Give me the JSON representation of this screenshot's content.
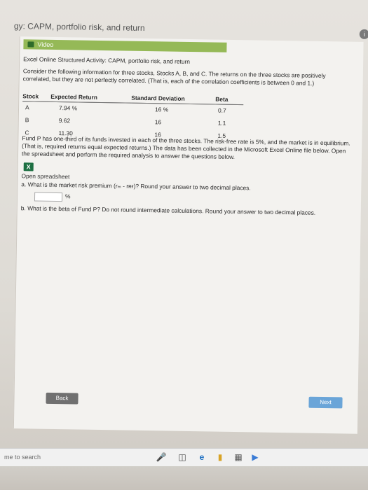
{
  "title": "gy: CAPM, portfolio risk, and return",
  "video_label": "Video",
  "activity_heading": "Excel Online Structured Activity: CAPM, portfolio risk, and return",
  "intro": "Consider the following information for three stocks, Stocks A, B, and C. The returns on the three stocks are positively correlated, but they are not perfectly correlated. (That is, each of the correlation coefficients is between 0 and 1.)",
  "table": {
    "headers": [
      "Stock",
      "Expected Return",
      "Standard Deviation",
      "Beta"
    ],
    "rows": [
      [
        "A",
        "7.94 %",
        "16 %",
        "0.7"
      ],
      [
        "B",
        "9.62",
        "16",
        "1.1"
      ],
      [
        "C",
        "11.30",
        "16",
        "1.5"
      ]
    ]
  },
  "fund_text": "Fund P has one-third of its funds invested in each of the three stocks. The risk-free rate is 5%, and the market is in equilibrium. (That is, required returns equal expected returns.) The data has been collected in the Microsoft Excel Online file below. Open the spreadsheet and perform the required analysis to answer the questions below.",
  "excel_icon_glyph": "X",
  "open_spreadsheet": "Open spreadsheet",
  "question_a": "a.  What is the market risk premium (rₘ - rʀғ)? Round your answer to two decimal places.",
  "question_a_unit": "%",
  "question_b": "b.  What is the beta of Fund P? Do not round intermediate calculations. Round your answer to two decimal places.",
  "back_label": "Back",
  "next_label": "Next",
  "taskbar": {
    "search_text": "me to search",
    "icons": [
      "microphone-icon",
      "task-view-icon",
      "edge-icon",
      "file-explorer-icon",
      "store-icon",
      "mail-icon"
    ]
  }
}
